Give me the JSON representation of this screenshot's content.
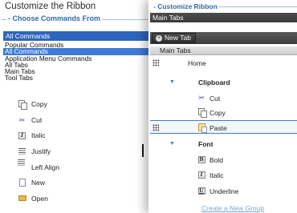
{
  "left": {
    "title": "Customize the Ribbon",
    "choose_legend": "Choose Commands From",
    "combo_value": "All Commands",
    "dropdown_options": [
      {
        "label": "Popular Commands",
        "selected": false
      },
      {
        "label": "All Commands",
        "selected": true
      },
      {
        "label": "Application Menu Commands",
        "selected": false
      },
      {
        "label": "All Tabs",
        "selected": false
      },
      {
        "label": "Main Tabs",
        "selected": false
      },
      {
        "label": "Tool Tabs",
        "selected": false
      }
    ],
    "commands": [
      {
        "label": "Copy",
        "icon": "copy-icon"
      },
      {
        "label": "Cut",
        "icon": "cut-icon"
      },
      {
        "label": "Italic",
        "icon": "italic-icon"
      },
      {
        "label": "Justify",
        "icon": "justify-icon"
      },
      {
        "label": "Left Align",
        "icon": "left-align-icon"
      },
      {
        "label": "New",
        "icon": "new-document-icon"
      },
      {
        "label": "Open",
        "icon": "open-folder-icon"
      }
    ]
  },
  "right": {
    "title": "Customize Ribbon",
    "tabs_combo_value": "Main Tabs",
    "new_tab_label": "New Tab",
    "header_label": "Main Tabs",
    "tree": {
      "home_label": "Home",
      "clipboard_group": "Clipboard",
      "clipboard_items": [
        "Cut",
        "Copy",
        "Paste"
      ],
      "font_group": "Font",
      "font_items": [
        "Bold",
        "Italic",
        "Underline"
      ]
    },
    "create_group_link": "Create a New Group"
  },
  "colors": {
    "accent_blue": "#2d6aa8",
    "selection_blue": "#3d7bd6",
    "dark_toolbar": "#3e3e3e"
  }
}
